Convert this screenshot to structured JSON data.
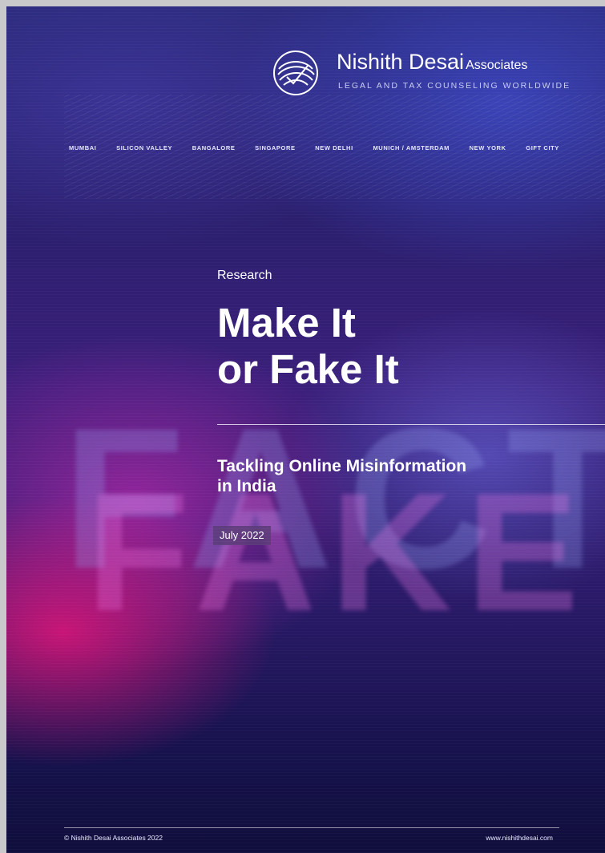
{
  "brand": {
    "name": "Nishith Desai",
    "name_suffix": "Associates",
    "tagline": "LEGAL AND TAX COUNSELING WORLDWIDE",
    "logo_icon": "nda-swirl-logo-icon"
  },
  "cities": [
    "MUMBAI",
    "SILICON VALLEY",
    "BANGALORE",
    "SINGAPORE",
    "NEW DELHI",
    "MUNICH / AMSTERDAM",
    "NEW YORK",
    "GIFT CITY"
  ],
  "cover": {
    "category": "Research",
    "title_lines": [
      "Make It",
      "or Fake It"
    ],
    "subtitle_lines": [
      "Tackling Online Misinformation",
      "in India"
    ],
    "date": "July 2022",
    "background_words": [
      "FACT",
      "FAKE"
    ]
  },
  "footer": {
    "copyright": "© Nishith Desai Associates 2022",
    "website": "www.nishithdesai.com"
  },
  "colors": {
    "deep_blue": "#2a2a7a",
    "magenta": "#e11478",
    "text": "#ffffff"
  }
}
